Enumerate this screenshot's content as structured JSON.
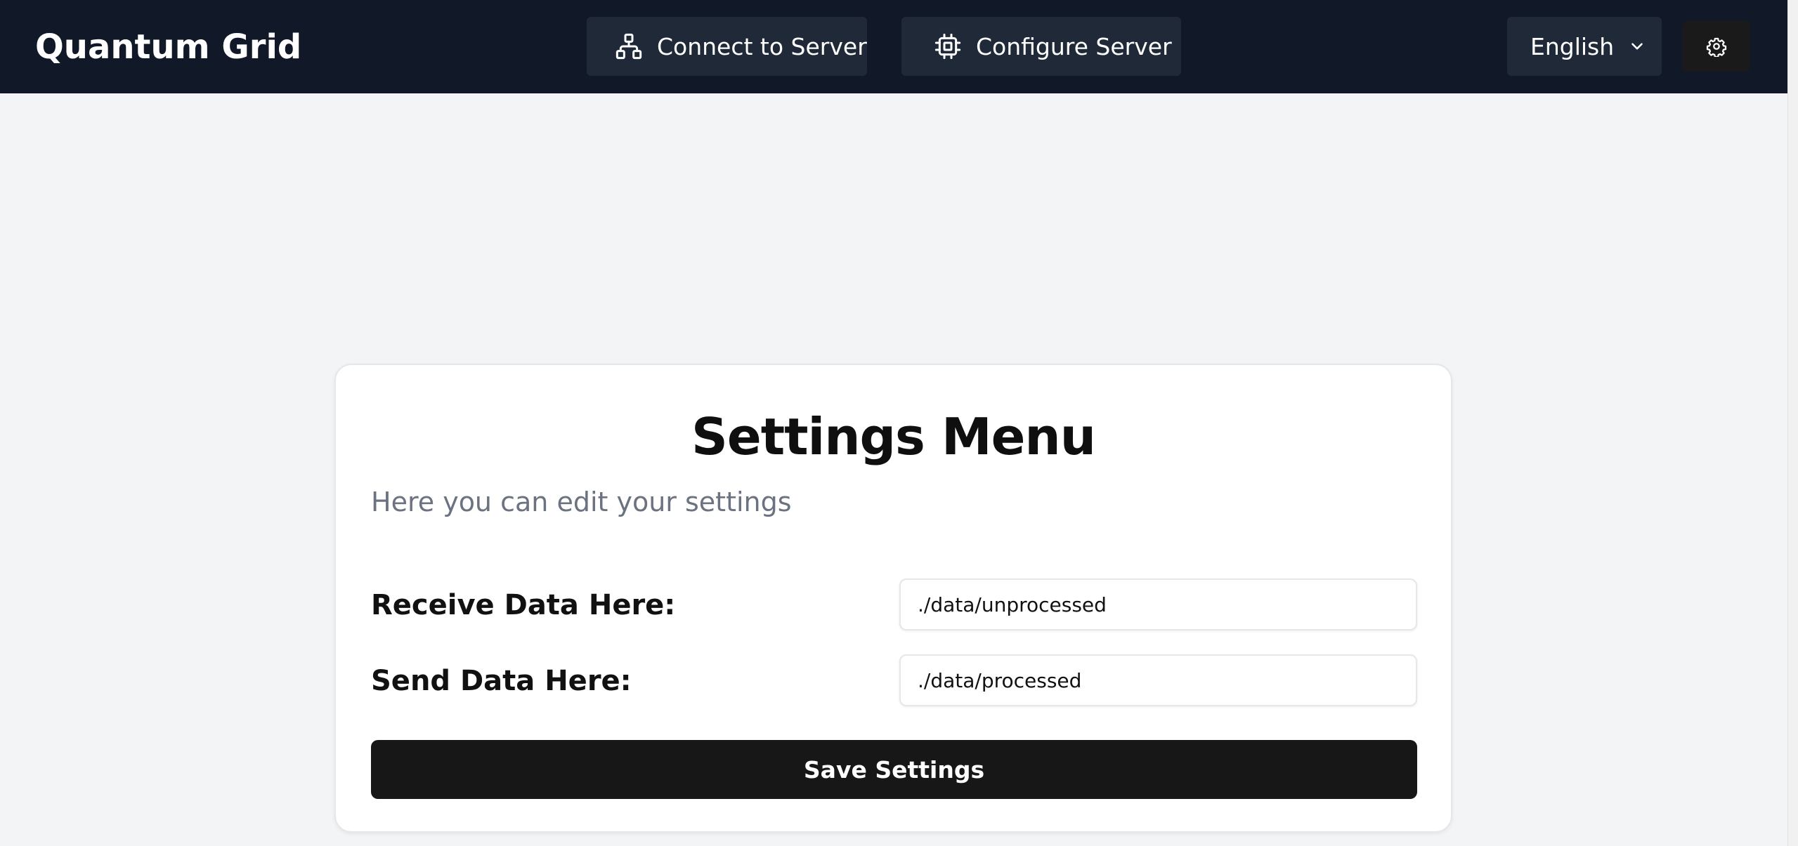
{
  "app": {
    "brand": "Quantum Grid"
  },
  "nav": {
    "connect_label": "Connect to Server",
    "configure_label": "Configure Server",
    "language_selected": "English"
  },
  "icons": {
    "connect": "network-icon",
    "configure": "cpu-chip-icon",
    "language": "chevron-down-icon",
    "settings": "gear-icon"
  },
  "settings": {
    "title": "Settings Menu",
    "subtitle": "Here you can edit your settings",
    "receive_label": "Receive Data Here:",
    "receive_value": "./data/unprocessed",
    "send_label": "Send Data Here:",
    "send_value": "./data/processed",
    "save_label": "Save Settings"
  },
  "colors": {
    "navbar": "#111827",
    "nav_button": "#1f2937",
    "page_background": "#f3f4f6",
    "primary_button": "#171717"
  }
}
